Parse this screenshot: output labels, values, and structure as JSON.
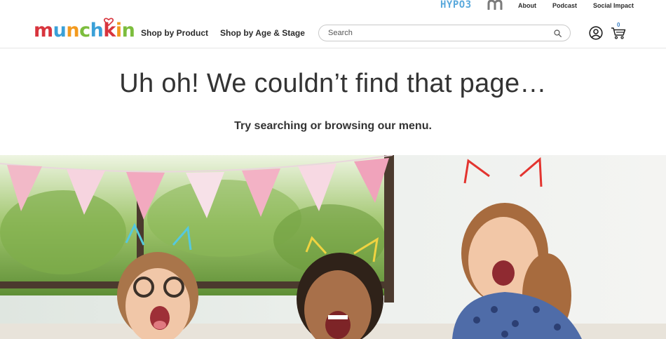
{
  "utility_nav": {
    "hypo3_label": "HYPO3",
    "about": "About",
    "podcast": "Podcast",
    "social_impact": "Social Impact"
  },
  "brand": {
    "logo_letters": [
      "m",
      "u",
      "n",
      "c",
      "h",
      "k",
      "i",
      "n"
    ],
    "logo_colors": [
      "#d8343d",
      "#3aa0d8",
      "#f39a1e",
      "#7cbd3d",
      "#3aa0d8",
      "#d8343d",
      "#f39a1e",
      "#7cbd3d"
    ]
  },
  "main_nav": {
    "shop_by_product": "Shop by Product",
    "shop_by_age": "Shop by Age & Stage"
  },
  "search": {
    "placeholder": "Search",
    "value": ""
  },
  "cart": {
    "count": "0"
  },
  "error": {
    "title": "Uh oh! We couldn’t find that page…",
    "subtitle": "Try searching or browsing our menu."
  },
  "colors": {
    "accent_blue": "#5aa9dc",
    "cart_count": "#3a7fc4",
    "text_dark": "#2b2b2b"
  }
}
